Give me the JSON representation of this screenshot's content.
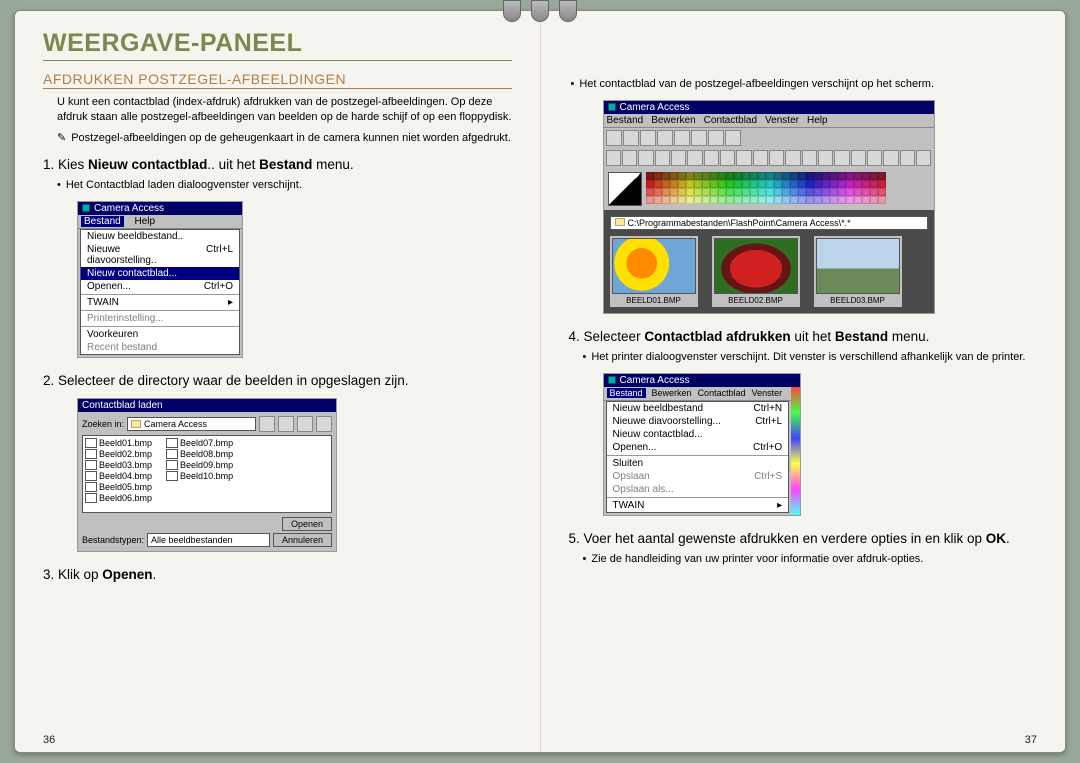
{
  "header": {
    "title": "WEERGAVE-PANEEL"
  },
  "left": {
    "section_title": "AFDRUKKEN POSTZEGEL-AFBEELDINGEN",
    "intro": "U kunt een contactblad (index-afdruk) afdrukken van de postzegel-afbeeldingen. Op deze afdruk staan alle postzegel-afbeeldingen van beelden op de harde schijf of op een floppydisk.",
    "note_icon": "✎",
    "note": "Postzegel-afbeeldingen op de geheugenkaart in de camera kunnen niet worden afgedrukt.",
    "step1_num": "1.",
    "step1_a": "Kies ",
    "step1_b": "Nieuw contactblad",
    "step1_c": ".. uit het ",
    "step1_d": "Bestand",
    "step1_e": " menu.",
    "bullet1": "Het Contactblad laden dialoogvenster verschijnt.",
    "step2": "2. Selecteer de directory waar de beelden in opgeslagen zijn.",
    "step3_a": "3. Klik op ",
    "step3_b": "Openen",
    "step3_c": ".",
    "page_num": "36"
  },
  "right": {
    "bullet_top": "Het contactblad van de postzegel-afbeeldingen verschijnt op het scherm.",
    "step4_num": "4.",
    "step4_a": "Selecteer ",
    "step4_b": "Contactblad afdrukken",
    "step4_c": " uit het ",
    "step4_d": "Bestand",
    "step4_e": " menu.",
    "bullet4": "Het printer dialoogvenster verschijnt. Dit venster is verschillend afhankelijk van de printer.",
    "step5_a": "5. Voer het aantal gewenste afdrukken en verdere opties in en klik op ",
    "step5_b": "OK",
    "step5_c": ".",
    "bullet5": "Zie de handleiding van uw printer voor informatie over afdruk-opties.",
    "page_num": "37"
  },
  "fig1": {
    "title": "Camera Access",
    "menu_bestand": "Bestand",
    "menu_help": "Help",
    "items": [
      {
        "label": "Nieuw beeldbestand..",
        "shortcut": ""
      },
      {
        "label": "Nieuwe diavoorstelling..",
        "shortcut": "Ctrl+L"
      },
      {
        "label": "Nieuw contactblad...",
        "shortcut": "",
        "selected": true
      },
      {
        "label": "Openen...",
        "shortcut": "Ctrl+O"
      },
      {
        "label": "TWAIN",
        "shortcut": "▸"
      },
      {
        "label": "Printerinstelling...",
        "shortcut": "",
        "disabled": true
      },
      {
        "label": "Voorkeuren",
        "shortcut": ""
      },
      {
        "label": "Recent bestand",
        "shortcut": "",
        "disabled": true
      }
    ]
  },
  "fig2": {
    "title": "Contactblad laden",
    "zoeken_label": "Zoeken in:",
    "zoeken_value": "Camera Access",
    "files_a": [
      "Beeld01.bmp",
      "Beeld02.bmp",
      "Beeld03.bmp",
      "Beeld04.bmp",
      "Beeld05.bmp",
      "Beeld06.bmp"
    ],
    "files_b": [
      "Beeld07.bmp",
      "Beeld08.bmp",
      "Beeld09.bmp",
      "Beeld10.bmp"
    ],
    "bestandstypen_label": "Bestandstypen:",
    "bestandstypen_value": "Alle beeldbestanden",
    "btn_open": "Openen",
    "btn_cancel": "Annuleren"
  },
  "fig3": {
    "title": "Camera Access",
    "menus": [
      "Bestand",
      "Bewerken",
      "Contactblad",
      "Venster",
      "Help"
    ],
    "path": "C:\\Programmabestanden\\FlashPoint\\Camera Access\\*.*",
    "thumbs": [
      {
        "cap": "BEELD01.BMP"
      },
      {
        "cap": "BEELD02.BMP"
      },
      {
        "cap": "BEELD03.BMP"
      }
    ]
  },
  "fig4": {
    "title": "Camera Access",
    "menus": [
      "Bestand",
      "Bewerken",
      "Contactblad",
      "Venster"
    ],
    "items": [
      {
        "label": "Nieuw beeldbestand",
        "shortcut": "Ctrl+N"
      },
      {
        "label": "Nieuwe diavoorstelling...",
        "shortcut": "Ctrl+L"
      },
      {
        "label": "Nieuw contactblad...",
        "shortcut": ""
      },
      {
        "label": "Openen...",
        "shortcut": "Ctrl+O"
      },
      {
        "label": "Sluiten",
        "shortcut": ""
      },
      {
        "label": "Opslaan",
        "shortcut": "Ctrl+S",
        "disabled": true
      },
      {
        "label": "Opslaan als...",
        "shortcut": "",
        "disabled": true
      },
      {
        "label": "TWAIN",
        "shortcut": "▸"
      }
    ]
  }
}
